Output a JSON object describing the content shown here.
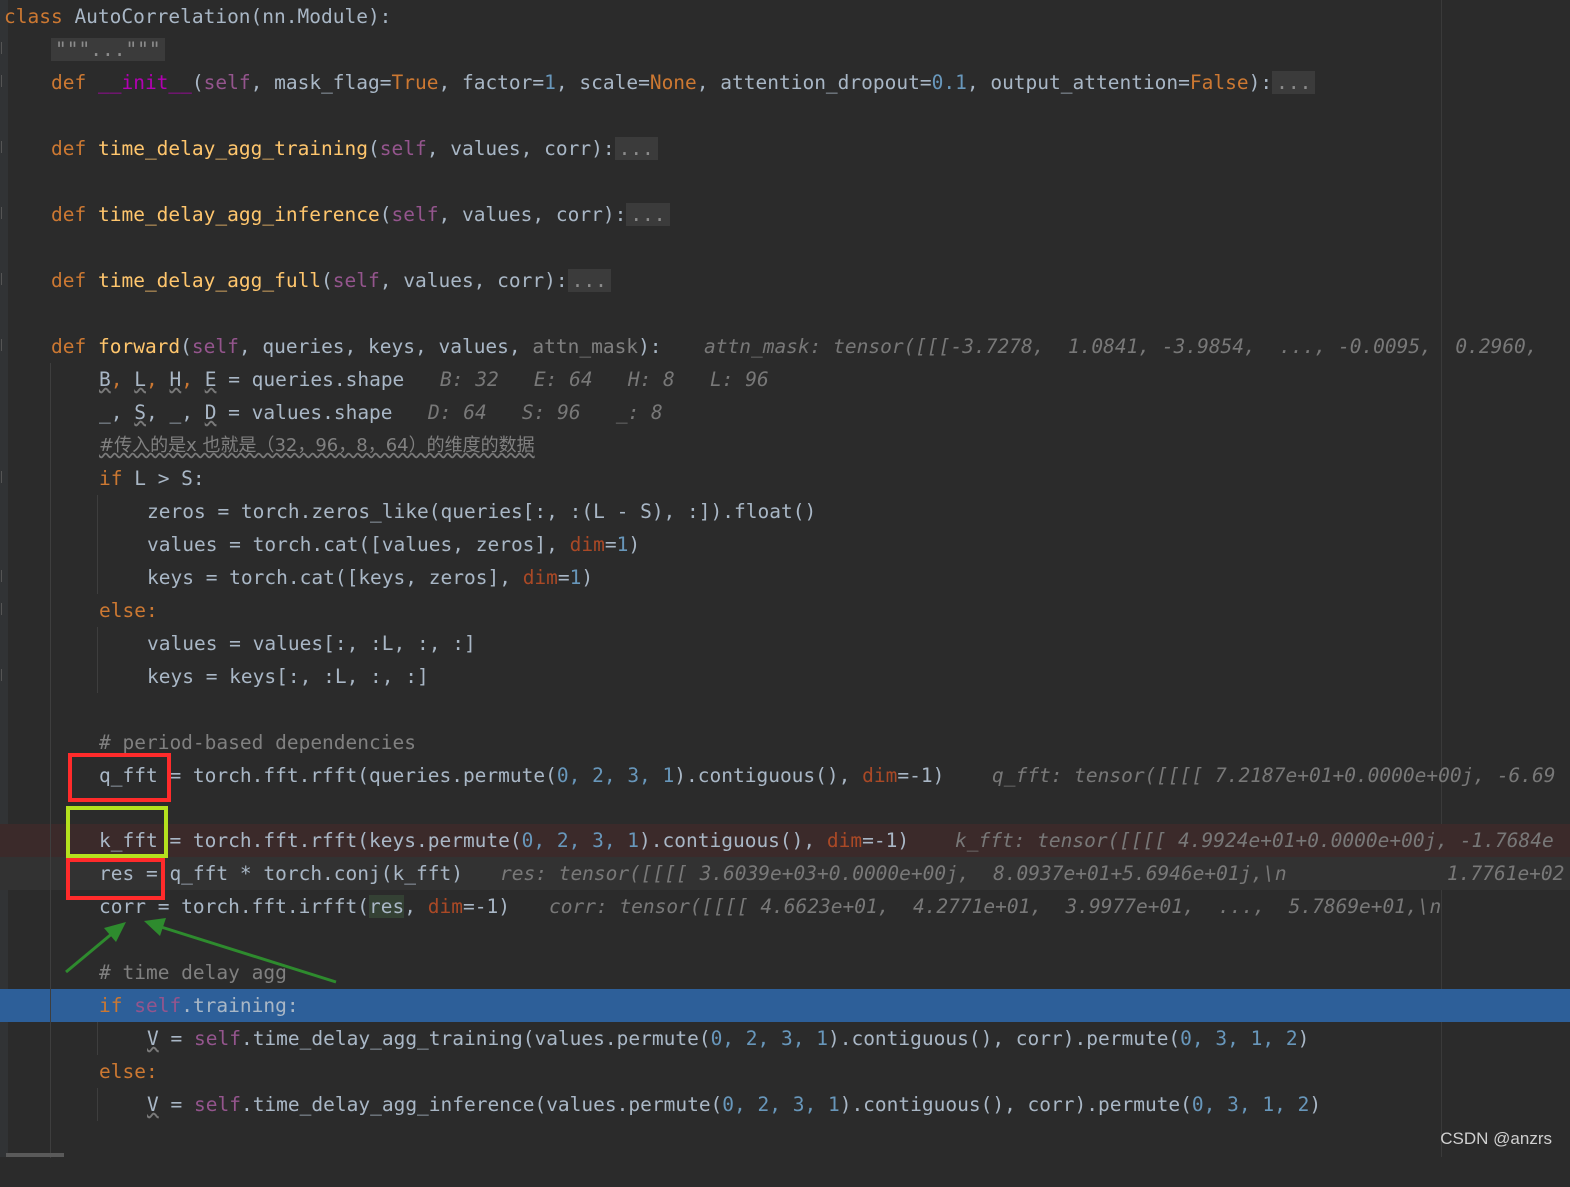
{
  "watermark": "CSDN @anzrs",
  "lines": {
    "l1_class": "class",
    "l1_name": " AutoCorrelation(nn.Module):",
    "l2_docfold": "\"\"\"...\"\"\"",
    "l3_def": "def",
    "l3_name": "__init__",
    "l3_a": "(",
    "l3_self": "self",
    "l3_b": ", mask_flag=",
    "l3_true": "True",
    "l3_c": ", factor=",
    "l3_one": "1",
    "l3_d": ", scale=",
    "l3_none": "None",
    "l3_e": ", attention_dropout=",
    "l3_drop": "0.1",
    "l3_f": ", output_attention=",
    "l3_false": "False",
    "l3_g": "):",
    "l3_fold": "...",
    "l4_def": "def",
    "l4_name": "time_delay_agg_training",
    "l4_a": "(",
    "l4_self": "self",
    "l4_b": ", values, corr):",
    "l4_fold": "...",
    "l5_def": "def",
    "l5_name": "time_delay_agg_inference",
    "l5_a": "(",
    "l5_self": "self",
    "l5_b": ", values, corr):",
    "l5_fold": "...",
    "l6_def": "def",
    "l6_name": "time_delay_agg_full",
    "l6_a": "(",
    "l6_self": "self",
    "l6_b": ", values, corr):",
    "l6_fold": "...",
    "l7_def": "def",
    "l7_name": "forward",
    "l7_a": "(",
    "l7_self": "self",
    "l7_b": ", queries, keys, values, ",
    "l7_attn": "attn_mask",
    "l7_c": "):",
    "l7_hint": "attn_mask: tensor([[[-3.7278,  1.0841, -3.9854,  ..., -0.0095,  0.2960,",
    "l8_B": "B",
    "l8_L": "L",
    "l8_H": "H",
    "l8_E": "E",
    "l8_rest": " = queries.shape",
    "l8_hint": "B: 32   E: 64   H: 8   L: 96",
    "l9_a": "_, ",
    "l9_S": "S",
    "l9_b": ", _, ",
    "l9_D": "D",
    "l9_rest": " = values.shape",
    "l9_hint": "D: 64   S: 96   _: 8",
    "l10_cmt": "#传入的是x 也就是（32，96，8，64）的维度的数据",
    "l11_if": "if",
    "l11_rest": " L > S:",
    "l12": "zeros = torch.zeros_like(queries[:, :(L - S), :]).float()",
    "l13_a": "values = torch.cat([values, zeros], ",
    "l13_dim": "dim",
    "l13_eq": "=",
    "l13_one": "1",
    "l13_end": ")",
    "l14_a": "keys = torch.cat([keys, zeros], ",
    "l14_dim": "dim",
    "l14_eq": "=",
    "l14_one": "1",
    "l14_end": ")",
    "l15_else": "else:",
    "l16": "values = values[:, :L, :, :]",
    "l17": "keys = keys[:, :L, :, :]",
    "l18_cmt": "# period-based dependencies",
    "l19_a": "q_fft = torch.fft.rfft(queries.permute(",
    "l19_nums": "0, 2, 3, 1",
    "l19_b": ").contiguous(), ",
    "l19_dim": "dim",
    "l19_c": "=-1)",
    "l19_hint": "q_fft: tensor([[[[ 7.2187e+01+0.0000e+00j, -6.69",
    "l20_a": "k_fft = torch.fft.rfft(keys.permute(",
    "l20_nums": "0, 2, 3, 1",
    "l20_b": ").contiguous(), ",
    "l20_dim": "dim",
    "l20_c": "=-1)",
    "l20_hint": "k_fft: tensor([[[[ 4.9924e+01+0.0000e+00j, -1.7684e",
    "l21_a": "res = q_fft * torch.conj(k_fft)",
    "l21_hint": "res: tensor([[[[ 3.6039e+03+0.0000e+00j,  8.0937e+01+5.6946e+01j,\\n",
    "l21_hint2": "1.7761e+02",
    "l22_a": "corr = torch.fft.irfft(",
    "l22_res": "res",
    "l22_b": ", ",
    "l22_dim": "dim",
    "l22_c": "=-1)",
    "l22_hint": "corr: tensor([[[[ 4.6623e+01,  4.2771e+01,  3.9977e+01,  ...,  5.7869e+01,\\n",
    "l23_cmt": "# time delay agg",
    "l24_if": "if",
    "l24_self": "self",
    "l24_rest": ".training:",
    "l25_V": "V",
    "l25_a": " = ",
    "l25_self": "self",
    "l25_b": ".time_delay_agg_training(values.permute(",
    "l25_n1": "0, 2, 3, 1",
    "l25_c": ").contiguous(), corr).permute(",
    "l25_n2": "0, 3, 1, 2",
    "l25_d": ")",
    "l26_else": "else:",
    "l27_V": "V",
    "l27_a": " = ",
    "l27_self": "self",
    "l27_b": ".time_delay_agg_inference(values.permute(",
    "l27_n1": "0, 2, 3, 1",
    "l27_c": ").contiguous(), corr).permute(",
    "l27_n2": "0, 3, 1, 2",
    "l27_d": ")"
  }
}
